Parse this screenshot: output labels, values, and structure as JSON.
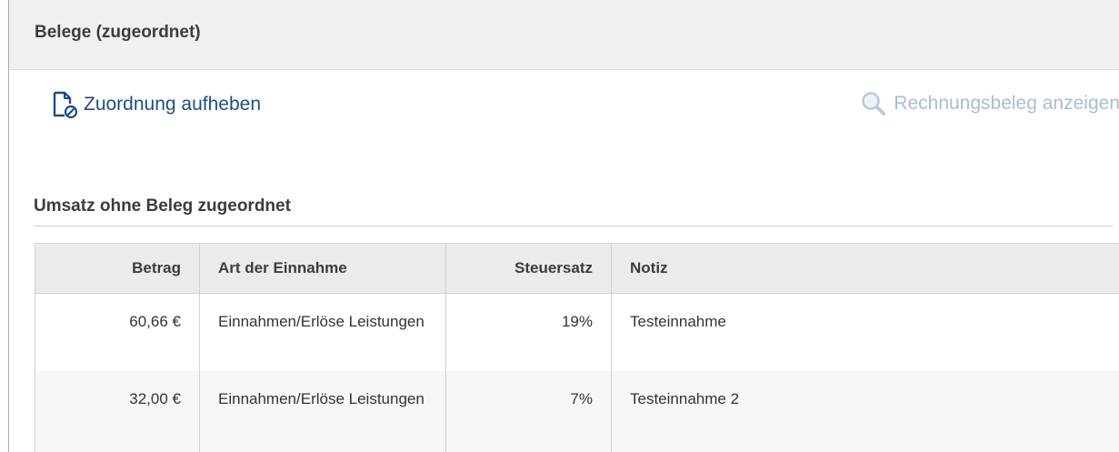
{
  "panel": {
    "title": "Belege (zugeordnet)"
  },
  "toolbar": {
    "unassign_label": "Zuordnung aufheben",
    "unassign_icon": "document-unlink-icon",
    "show_receipt_label": "Rechnungsbeleg anzeigen",
    "show_receipt_icon": "magnifier-icon",
    "show_receipt_enabled": false
  },
  "section": {
    "title": "Umsatz ohne Beleg zugeordnet"
  },
  "table": {
    "columns": [
      "Betrag",
      "Art der Einnahme",
      "Steuersatz",
      "Notiz"
    ],
    "rows": [
      {
        "betrag": "60,66 €",
        "art": "Einnahmen/Erlöse Leistungen",
        "steuersatz": "19%",
        "notiz": "Testeinnahme"
      },
      {
        "betrag": "32,00 €",
        "art": "Einnahmen/Erlöse Leistungen",
        "steuersatz": "7%",
        "notiz": "Testeinnahme 2"
      }
    ]
  },
  "colors": {
    "link": "#1e4d86",
    "disabled_link": "#a9bdd3",
    "header_bg": "#f0f0f0",
    "panel_border": "#9aaec7"
  }
}
